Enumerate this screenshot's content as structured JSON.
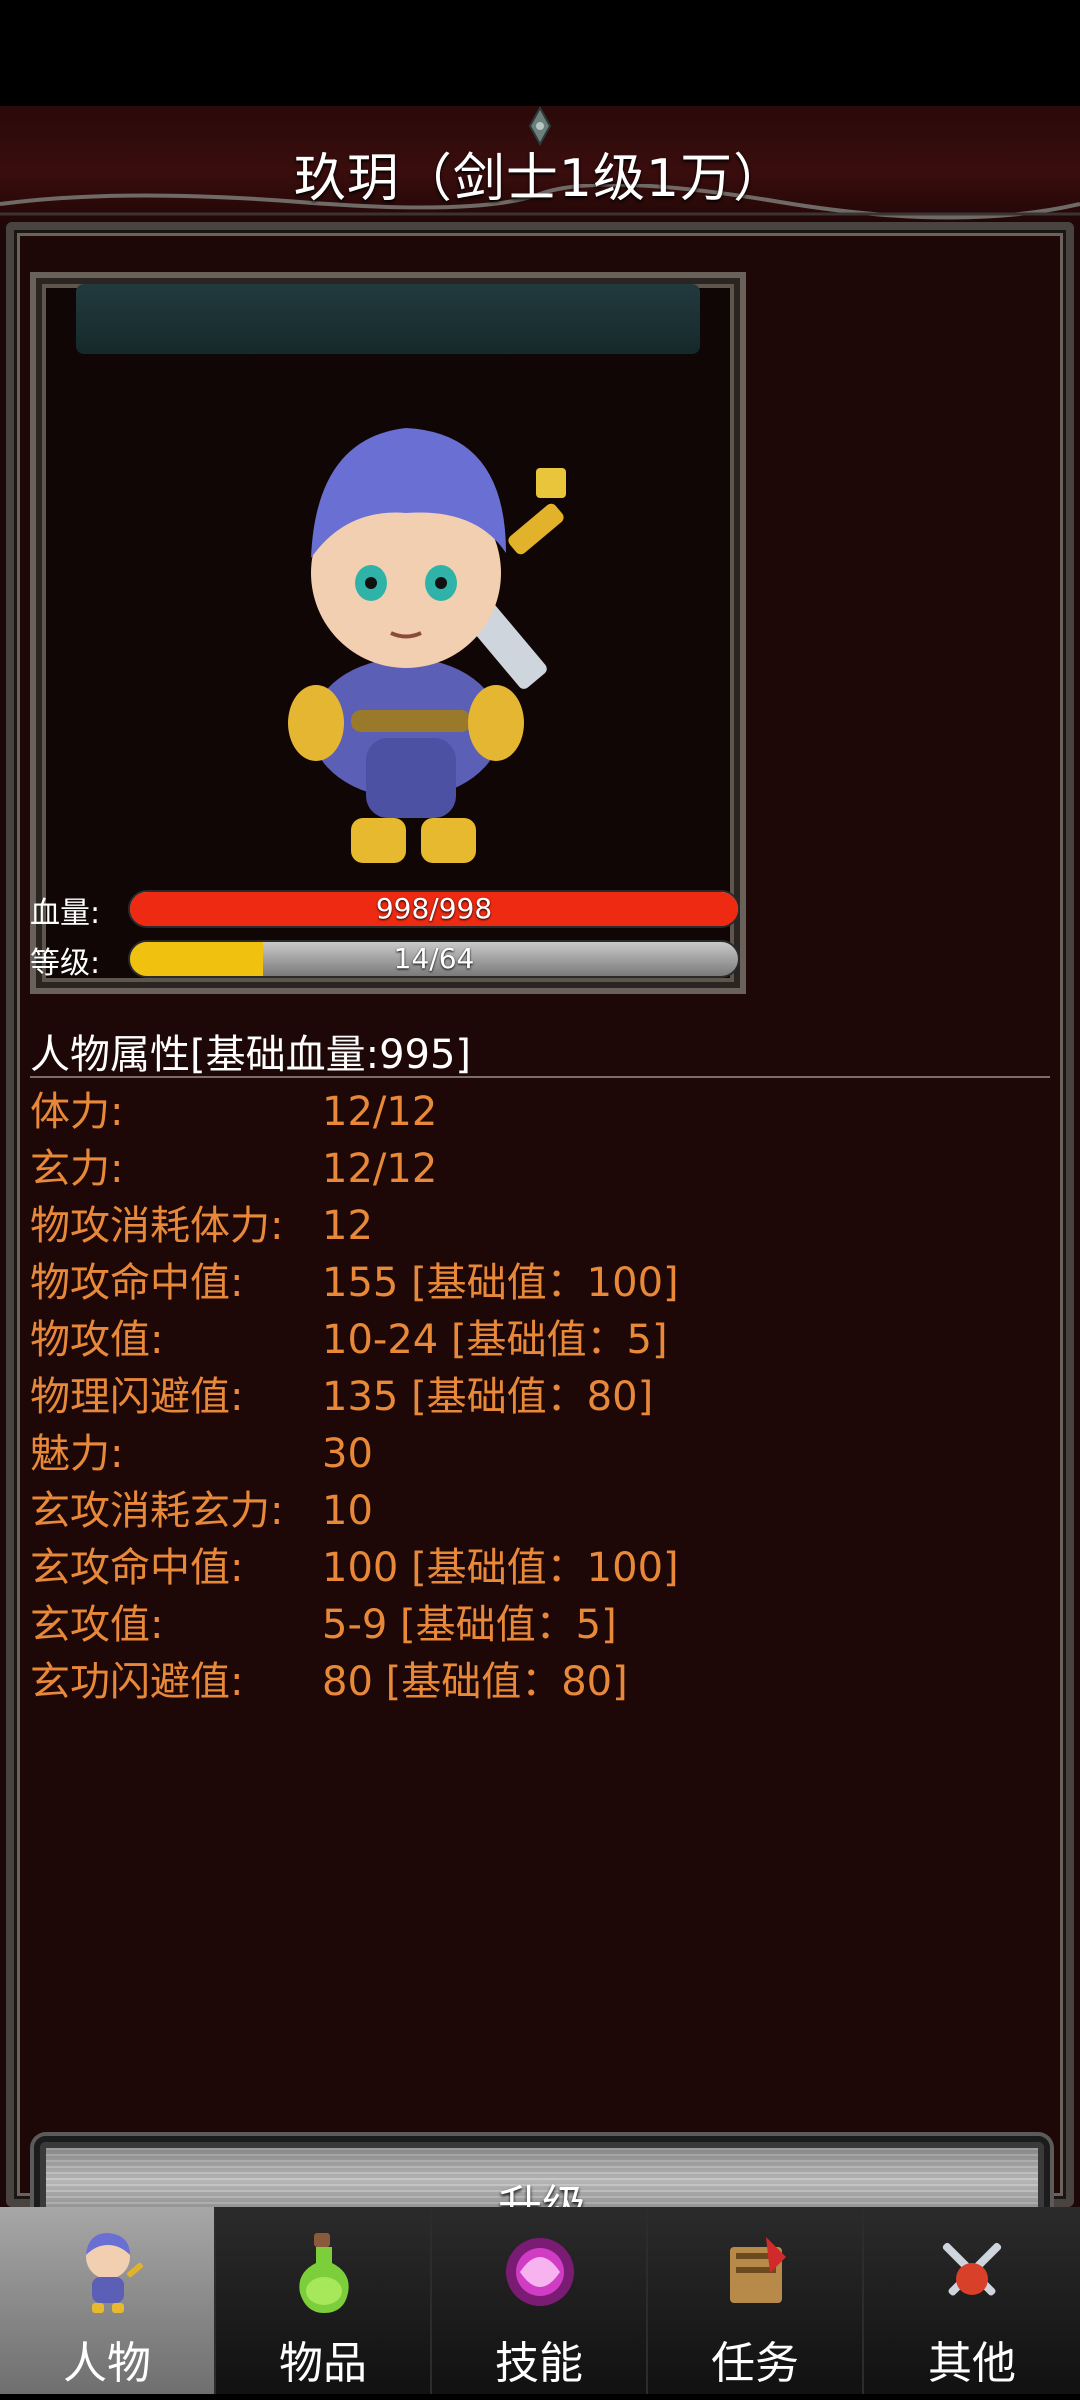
{
  "header": {
    "title": "玖玥（剑士1级1万）"
  },
  "stats": {
    "hp_label": "血量:",
    "hp_text": "998/998",
    "hp_fraction": 1.0,
    "level_label": "等级:",
    "level_text": "14/64",
    "level_fraction": 0.21875
  },
  "attributes": {
    "title": "人物属性[基础血量:995]",
    "rows": [
      {
        "key": "体力:",
        "value": "12/12"
      },
      {
        "key": "玄力:",
        "value": "12/12"
      },
      {
        "key": "物攻消耗体力:",
        "value": "12"
      },
      {
        "key": "物攻命中值:",
        "value": "155 [基础值：100]"
      },
      {
        "key": "物攻值:",
        "value": "10-24 [基础值：5]"
      },
      {
        "key": "物理闪避值:",
        "value": "135 [基础值：80]"
      },
      {
        "key": "魅力:",
        "value": "30"
      },
      {
        "key": "玄攻消耗玄力:",
        "value": "10"
      },
      {
        "key": "玄攻命中值:",
        "value": "100 [基础值：100]"
      },
      {
        "key": "玄攻值:",
        "value": "5-9 [基础值：5]"
      },
      {
        "key": "玄功闪避值:",
        "value": "80 [基础值：80]"
      }
    ]
  },
  "upgrade_button": {
    "label": "升级"
  },
  "nav": {
    "items": [
      {
        "label": "人物",
        "icon": "character-icon"
      },
      {
        "label": "物品",
        "icon": "potion-icon"
      },
      {
        "label": "技能",
        "icon": "skill-orb-icon"
      },
      {
        "label": "任务",
        "icon": "quest-icon"
      },
      {
        "label": "其他",
        "icon": "crossed-swords-icon"
      }
    ],
    "active_index": 0
  },
  "colors": {
    "hp_fill": "#ee2a12",
    "level_fill": "#f0c10e",
    "attribute_text": "#e8893a",
    "background": "#1c0808"
  }
}
